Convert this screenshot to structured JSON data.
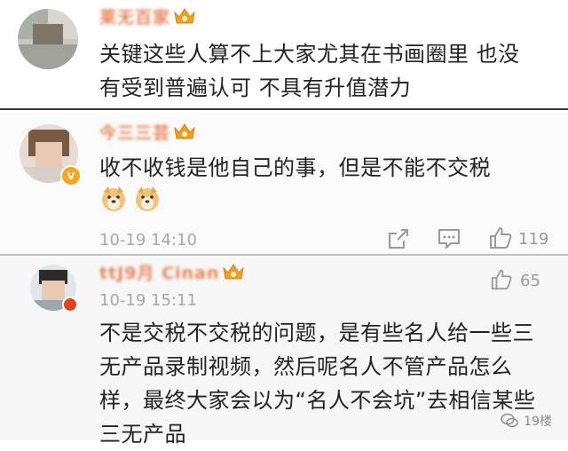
{
  "comments": [
    {
      "username": "莱无百家",
      "text_lines": [
        "关键这些人算不上大家尤其在书画圈里 也没",
        "有受到普遍认可 不具有升值潜力"
      ]
    },
    {
      "username": "今三三芸",
      "badge": "V",
      "text_lines": [
        "收不收钱是他自己的事，但是不能不交税"
      ],
      "emoji": [
        "doge-emoji",
        "doge-emoji"
      ],
      "time": "10-19 14:10",
      "like_count": "119"
    },
    {
      "username": "ttJ9月 Cinan",
      "time": "10-19 15:11",
      "like_count": "65",
      "text_lines": [
        "不是交税不交税的问题，是有些名人给一些三",
        "无产品录制视频，然后呢名人不管产品怎么",
        "样，最终大家会以为“名人不会坑”去相信某些",
        "三无产品"
      ]
    }
  ],
  "watermark": "19楼",
  "colors": {
    "username": "#e8855a",
    "crown": "#f0a020",
    "verified": "#f5a623",
    "text": "#222222",
    "meta": "#a8a8a8"
  }
}
